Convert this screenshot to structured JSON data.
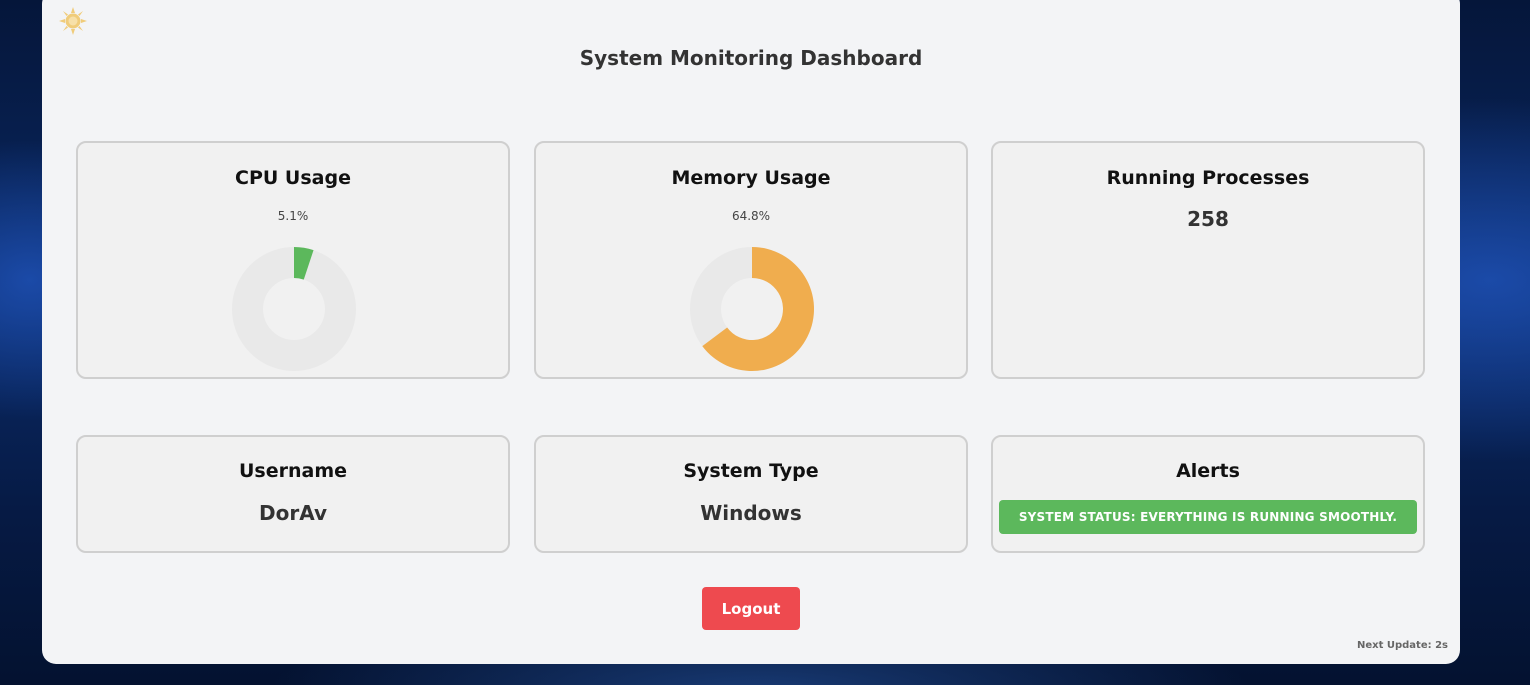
{
  "header": {
    "title": "System Monitoring Dashboard",
    "theme_toggle_icon": "sun-icon"
  },
  "cards": {
    "cpu": {
      "title": "CPU Usage",
      "percent_label": "5.1%",
      "percent": 5.1,
      "color": "#5cb85c"
    },
    "memory": {
      "title": "Memory Usage",
      "percent_label": "64.8%",
      "percent": 64.8,
      "color": "#f0ad4e"
    },
    "processes": {
      "title": "Running Processes",
      "value": "258"
    },
    "username": {
      "title": "Username",
      "value": "DorAv"
    },
    "system_type": {
      "title": "System Type",
      "value": "Windows"
    },
    "alerts": {
      "title": "Alerts",
      "message": "System Status: Everything is running smoothly.",
      "color": "#5cb85c"
    }
  },
  "actions": {
    "logout_label": "Logout",
    "logout_color": "#ee4a4f"
  },
  "footer": {
    "next_update": "Next Update: 2s"
  },
  "colors": {
    "donut_track": "#e9e9e9",
    "panel_bg": "#f3f4f6",
    "card_bg": "#f1f1f1"
  }
}
